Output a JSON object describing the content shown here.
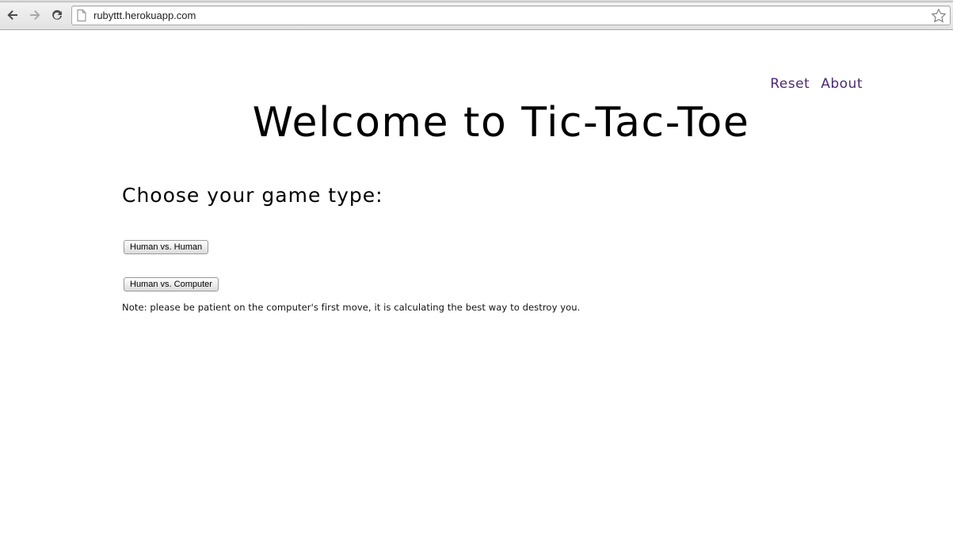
{
  "browser": {
    "url": "rubyttt.herokuapp.com",
    "icons": {
      "back": "back-arrow-icon",
      "forward": "forward-arrow-icon",
      "reload": "reload-icon",
      "page": "page-icon",
      "bookmark": "star-icon"
    }
  },
  "nav": {
    "reset_label": "Reset",
    "about_label": "About",
    "link_color": "#4b2a73"
  },
  "main": {
    "title": "Welcome to Tic-Tac-Toe",
    "heading": "Choose your game type:",
    "buttons": {
      "human_vs_human": "Human vs. Human",
      "human_vs_computer": "Human vs. Computer"
    },
    "note": "Note: please be patient on the computer's first move, it is calculating the best way to destroy you."
  }
}
